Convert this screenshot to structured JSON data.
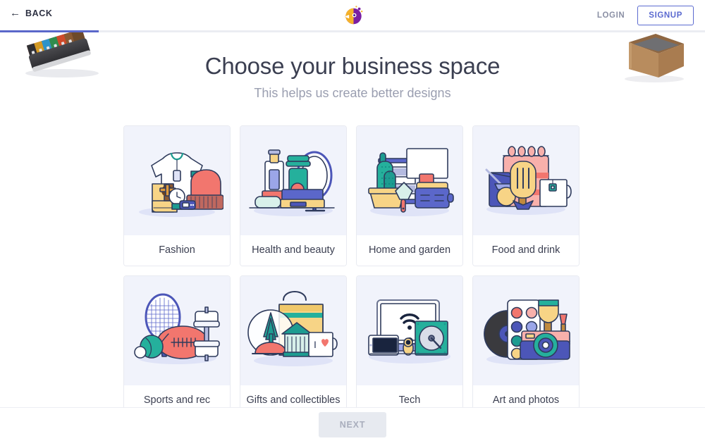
{
  "header": {
    "back_label": "BACK",
    "back_icon": "arrow-left-icon",
    "logo_icon": "vistacreate-bird-logo",
    "login_label": "LOGIN",
    "signup_label": "SIGNUP",
    "login_color": "#8b90a5",
    "signup_color": "#5b6ad0"
  },
  "progress": {
    "percent": 14,
    "fill_color": "#5b67ca",
    "track_color": "#ebedf2"
  },
  "background": {
    "left_photo": "colored-markers-photo",
    "right_photo": "wooden-box-photo"
  },
  "main": {
    "title": "Choose your business space",
    "subtitle": "This helps us create better designs",
    "card_art_bg": "#f1f3fb",
    "card_border": "#e8eaf1",
    "cards": [
      {
        "label": "Fashion",
        "art": "fashion-illustration"
      },
      {
        "label": "Health and beauty",
        "art": "health-beauty-illustration"
      },
      {
        "label": "Home and garden",
        "art": "home-garden-illustration"
      },
      {
        "label": "Food and drink",
        "art": "food-drink-illustration"
      },
      {
        "label": "Sports and rec",
        "art": "sports-rec-illustration"
      },
      {
        "label": "Gifts and collectibles",
        "art": "gifts-collectibles-illustration"
      },
      {
        "label": "Tech",
        "art": "tech-illustration"
      },
      {
        "label": "Art and photos",
        "art": "art-photos-illustration"
      }
    ]
  },
  "footer": {
    "next_label": "NEXT",
    "next_disabled": true,
    "next_bg": "#e7eaf0",
    "next_text_color": "#a9aebd"
  },
  "mug_text": "I"
}
